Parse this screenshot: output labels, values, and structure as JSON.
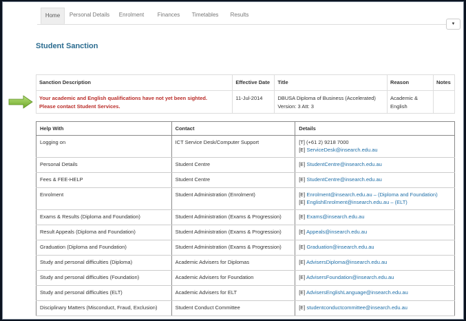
{
  "nav": {
    "tabs": [
      "Home",
      "Personal Details",
      "Enrolment",
      "Finances",
      "Timetables",
      "Results"
    ]
  },
  "page_title": "Student Sanction",
  "sanction": {
    "headers": [
      "Sanction Description",
      "Effective Date",
      "Title",
      "Reason",
      "Notes"
    ],
    "row": {
      "description_line1": "Your academic and English qualifications have not yet been sighted.",
      "description_line2": "Please contact Student Services.",
      "effective_date": "11-Jul-2014",
      "title_line1": "DBUSA Diploma of Business (Accelerated)",
      "title_line2": "Version: 3 Att: 3",
      "reason_line1": "Academic &",
      "reason_line2": "English",
      "notes": ""
    }
  },
  "help": {
    "headers": [
      "Help With",
      "Contact",
      "Details"
    ],
    "rows": [
      {
        "help": "Logging on",
        "contact": "ICT Service Desk/Computer Support",
        "d1_prefix": "[T] (+61 2) 9218 7000",
        "d2_prefix": "[E] ",
        "d2_link": "ServiceDesk@insearch.edu.au"
      },
      {
        "help": "Personal Details",
        "contact": "Student Centre",
        "prefix": "[E] ",
        "link": "StudentCentre@insearch.edu.au"
      },
      {
        "help": "Fees & FEE-HELP",
        "contact": "Student Centre",
        "prefix": "[E] ",
        "link": "StudentCentre@insearch.edu.au"
      },
      {
        "help": "Enrolment",
        "contact": "Student Administration (Enrolment)",
        "d1_prefix": "[E] ",
        "d1_link": "Enrolment@insearch.edu.au",
        "d1_suffix": " – (Diploma and Foundation)",
        "d2_prefix": "[E] ",
        "d2_link": "EnglishEnrolment@insearch.edu.au",
        "d2_suffix": " – (ELT)"
      },
      {
        "help": "Exams & Results (Diploma and Foundation)",
        "contact": "Student Administration (Exams & Progression)",
        "prefix": "[E] ",
        "link": "Exams@insearch.edu.au"
      },
      {
        "help": "Result Appeals (Diploma and Foundation)",
        "contact": "Student Administration (Exams & Progression)",
        "prefix": "[E] ",
        "link": "Appeals@insearch.edu.au"
      },
      {
        "help": "Graduation (Diploma and Foundation)",
        "contact": "Student Administration (Exams & Progression)",
        "prefix": "[E] ",
        "link": "Graduation@insearch.edu.au"
      },
      {
        "help": "Study and personal difficulties (Diploma)",
        "contact": "Academic Advisers for Diplomas",
        "prefix": "[E] ",
        "link": "AdvisersDiploma@insearch.edu.au"
      },
      {
        "help": "Study and personal difficulties (Foundation)",
        "contact": "Academic Advisers for Foundation",
        "prefix": "[E] ",
        "link": "AdvisersFoundation@insearch.edu.au"
      },
      {
        "help": "Study and personal difficulties (ELT)",
        "contact": "Academic Advisers for ELT",
        "prefix": "[E] ",
        "link": "AdvisersEnglishLanguage@insearch.edu.au"
      },
      {
        "help": "Disciplinary Matters (Misconduct, Fraud, Exclusion)",
        "contact": "Student Conduct Committee",
        "prefix": "[E] ",
        "link": "studentconductcommittee@insearch.edu.au"
      }
    ]
  },
  "colors": {
    "accent": "#2a6b8f",
    "warning": "#b92c28",
    "link": "#1f6fa8",
    "arrow": "#8dc63f"
  },
  "icons": {
    "pointer_arrow": "arrow-right-icon",
    "dropdown": "caret-down-icon"
  }
}
